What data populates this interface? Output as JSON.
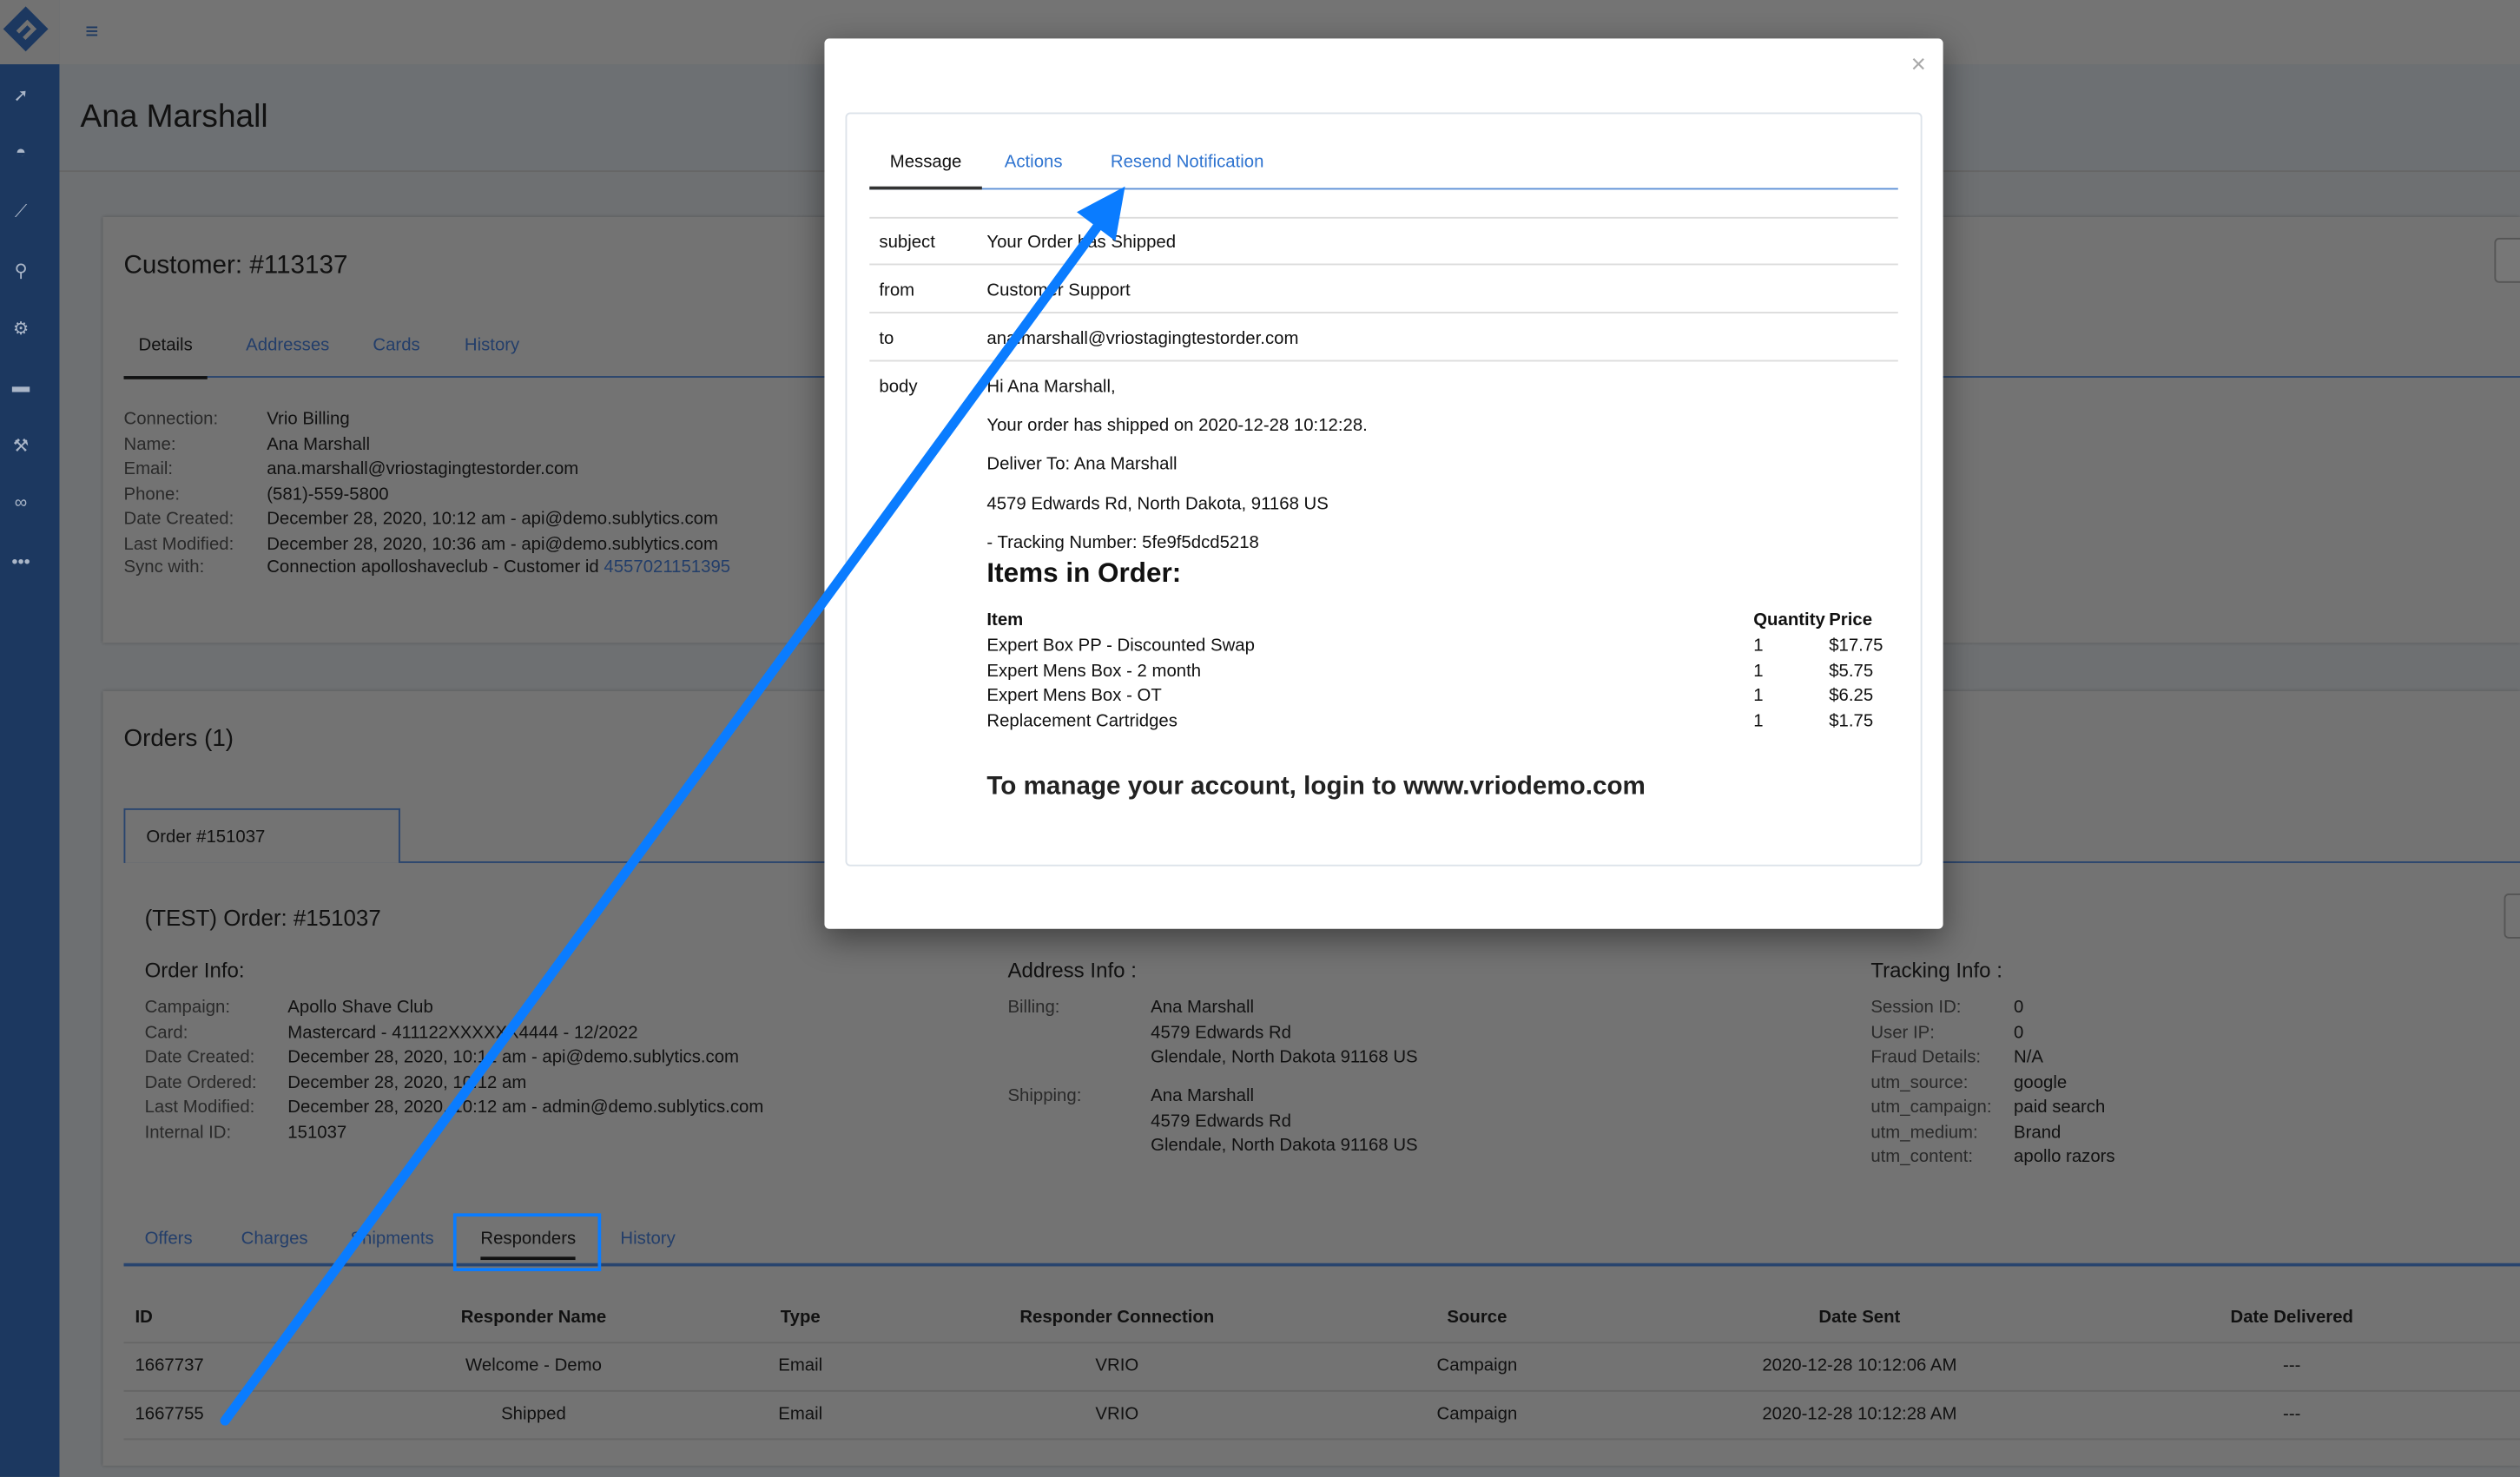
{
  "page": {
    "title": "Ana Marshall"
  },
  "sidebar": {
    "icons": [
      "rocket-icon",
      "dashboard-icon",
      "chart-icon",
      "search-icon",
      "gears-icon",
      "credit-card-icon",
      "wrench-icon",
      "link-icon",
      "more-icon"
    ]
  },
  "customer": {
    "title": "Customer: #113137",
    "tabs": [
      "Details",
      "Addresses",
      "Cards",
      "History"
    ],
    "fields": [
      [
        "Connection:",
        "Vrio Billing"
      ],
      [
        "Name:",
        "Ana Marshall"
      ],
      [
        "Email:",
        "ana.marshall@vriostagingtestorder.com"
      ],
      [
        "Phone:",
        "(581)-559-5800"
      ],
      [
        "Date Created:",
        "December 28, 2020, 10:12 am - api@demo.sublytics.com"
      ],
      [
        "Last Modified:",
        "December 28, 2020, 10:36 am - api@demo.sublytics.com"
      ]
    ],
    "sync_label": "Sync with:",
    "sync_text": "Connection apolloshaveclub - Customer id ",
    "sync_link": "4557021151395"
  },
  "orders": {
    "title": "Orders (1)",
    "order_tab": "Order #151037",
    "order_title": "(TEST) Order: #151037",
    "order_info": {
      "heading": "Order Info:",
      "fields": [
        [
          "Campaign:",
          "Apollo Shave Club"
        ],
        [
          "Card:",
          "Mastercard - 411122XXXXXX4444 - 12/2022"
        ],
        [
          "Date Created:",
          "December 28, 2020, 10:12 am - api@demo.sublytics.com"
        ],
        [
          "Date Ordered:",
          "December 28, 2020, 10:12 am"
        ],
        [
          "Last Modified:",
          "December 28, 2020, 10:12 am - admin@demo.sublytics.com"
        ],
        [
          "Internal ID:",
          "151037"
        ]
      ]
    },
    "address_info": {
      "heading": "Address Info :",
      "billing_label": "Billing:",
      "billing": [
        "Ana Marshall",
        "4579 Edwards Rd",
        "Glendale, North Dakota 91168 US"
      ],
      "shipping_label": "Shipping:",
      "shipping": [
        "Ana Marshall",
        "4579 Edwards Rd",
        "Glendale, North Dakota 91168 US"
      ]
    },
    "tracking_info": {
      "heading": "Tracking Info :",
      "fields": [
        [
          "Session ID:",
          "0"
        ],
        [
          "User IP:",
          "0"
        ],
        [
          "Fraud Details:",
          "N/A"
        ],
        [
          "utm_source:",
          "google"
        ],
        [
          "utm_campaign:",
          "paid search"
        ],
        [
          "utm_medium:",
          "Brand"
        ],
        [
          "utm_content:",
          "apollo razors"
        ]
      ]
    },
    "tabs": [
      "Offers",
      "Charges",
      "Shipments",
      "Responders",
      "History"
    ],
    "active_tab": "Responders",
    "table": {
      "headers": [
        "ID",
        "Responder Name",
        "Type",
        "Responder Connection",
        "Source",
        "Date Sent",
        "Date Delivered"
      ],
      "rows": [
        [
          "1667737",
          "Welcome - Demo",
          "Email",
          "VRIO",
          "Campaign",
          "2020-12-28 10:12:06 AM",
          "---"
        ],
        [
          "1667755",
          "Shipped",
          "Email",
          "VRIO",
          "Campaign",
          "2020-12-28 10:12:28 AM",
          "---"
        ]
      ]
    }
  },
  "modal": {
    "close": "×",
    "tabs": [
      "Message",
      "Actions",
      "Resend Notification"
    ],
    "active_tab": "Message",
    "subject_label": "subject",
    "subject": "Your Order has Shipped",
    "from_label": "from",
    "from": "Customer Support",
    "to_label": "to",
    "to": "ana.marshall@vriostagingtestorder.com",
    "body_label": "body",
    "body": {
      "greeting": "Hi Ana Marshall,",
      "shipped": "Your order has shipped on 2020-12-28 10:12:28.",
      "deliver": "Deliver To: Ana Marshall",
      "address": "4579 Edwards Rd, North Dakota, 91168 US",
      "tracking": "- Tracking Number: 5fe9f5dcd5218",
      "items_heading": "Items in Order:",
      "items_headers": [
        "Item",
        "Quantity",
        "Price"
      ],
      "items": [
        [
          "Expert Box PP - Discounted Swap",
          "1",
          "$17.75"
        ],
        [
          "Expert Mens Box - 2 month",
          "1",
          "$5.75"
        ],
        [
          "Expert Mens Box - OT",
          "1",
          "$6.25"
        ],
        [
          "Replacement Cartridges",
          "1",
          "$1.75"
        ]
      ],
      "footer": "To manage your account, login to www.vriodemo.com"
    }
  },
  "annotation": {
    "color": "#0a7cff"
  }
}
